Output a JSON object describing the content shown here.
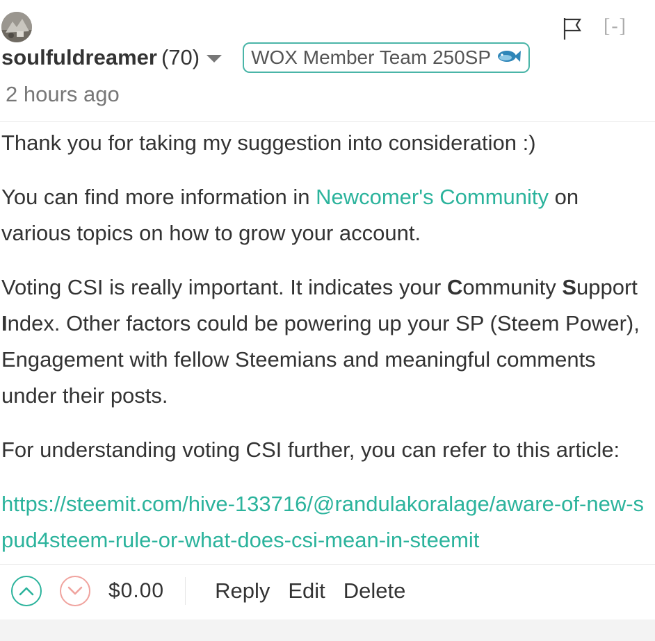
{
  "comment": {
    "author": "soulfuldreamer",
    "reputation": "(70)",
    "badge_label": "WOX Member Team 250SP",
    "collapse_label": "[-]",
    "timestamp": "2 hours ago",
    "paragraphs": {
      "p1": "Thank you for taking my suggestion into consideration :)",
      "p2_before": "You can find more information in ",
      "p2_link": "Newcomer's Community",
      "p2_after": " on various topics on how to grow your account.",
      "p3_a": "Voting CSI is really important. It indicates your ",
      "p3_c": "C",
      "p3_b": "ommunity ",
      "p3_s": "S",
      "p3_c2": "upport ",
      "p3_i": "I",
      "p3_d": "ndex. Other factors could be powering up your SP (Steem Power), Engagement with fellow Steemians and meaningful comments under their posts.",
      "p4": "For understanding voting CSI further, you can refer to this article:",
      "p5_link": "https://steemit.com/hive-133716/@randulakoralage/aware-of-new-spud4steem-rule-or-what-does-csi-mean-in-steemit"
    }
  },
  "footer": {
    "payout": "$0.00",
    "reply_label": "Reply",
    "edit_label": "Edit",
    "delete_label": "Delete"
  },
  "colors": {
    "link": "#2bb39c",
    "upvote": "#2bb39c",
    "downvote": "#f0a39e",
    "badge_border": "#4ab5a8"
  },
  "icons": {
    "avatar": "user-avatar",
    "dropdown": "caret-down-icon",
    "badge_icon": "fish-icon",
    "flag": "flag-icon",
    "upvote": "chevron-up-circle-icon",
    "downvote": "chevron-down-circle-icon"
  }
}
